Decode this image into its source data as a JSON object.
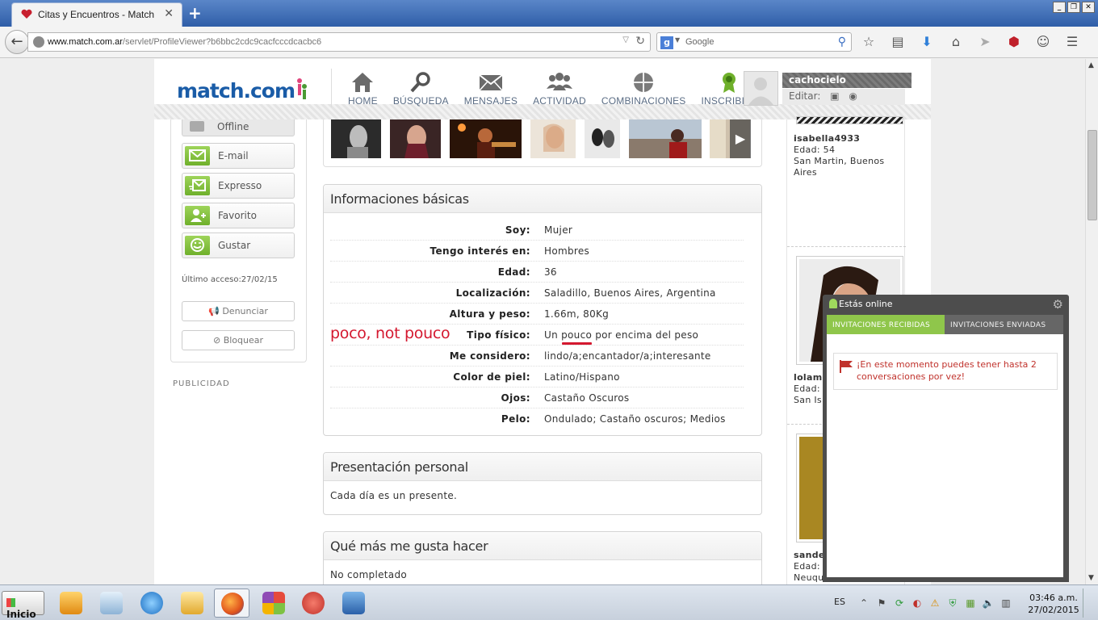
{
  "browser": {
    "tab_title": "Citas y Encuentros - Match",
    "url_domain": "www.match.com.ar",
    "url_path": "/servlet/ProfileViewer?b6bbc2cdc9cacfcccdcacbc6",
    "search_placeholder": "Google",
    "new_tab": "+",
    "close_tab": "✕"
  },
  "site": {
    "logo_text": "match.com",
    "nav": [
      {
        "label": "HOME",
        "icon": "home-icon"
      },
      {
        "label": "BÚSQUEDA",
        "icon": "search-icon"
      },
      {
        "label": "MENSAJES",
        "icon": "envelope-icon"
      },
      {
        "label": "ACTIVIDAD",
        "icon": "people-icon"
      },
      {
        "label": "COMBINACIONES",
        "icon": "puzzle-icon"
      },
      {
        "label": "INSCRIBITE",
        "icon": "ribbon-icon"
      }
    ],
    "user": {
      "name": "cachocielo",
      "edit_label": "Editar:"
    }
  },
  "sidebar": {
    "status": "Offline",
    "actions": [
      "E-mail",
      "Expresso",
      "Favorito",
      "Gustar"
    ],
    "last_access": "Último acceso:27/02/15",
    "report": "Denunciar",
    "block": "Bloquear",
    "ads": "PUBLICIDAD"
  },
  "basic_info": {
    "title": "Informaciones básicas",
    "rows": [
      {
        "k": "Soy:",
        "v": "Mujer"
      },
      {
        "k": "Tengo interés en:",
        "v": "Hombres"
      },
      {
        "k": "Edad:",
        "v": "36"
      },
      {
        "k": "Localización:",
        "v": "Saladillo, Buenos Aires, Argentina"
      },
      {
        "k": "Altura y peso:",
        "v": "1.66m, 80Kg"
      },
      {
        "k": "Tipo físico:",
        "v_pre": "Un ",
        "v_mark": "pouco",
        "v_post": " por encima del peso"
      },
      {
        "k": "Me considero:",
        "v": "lindo/a;encantador/a;interesante"
      },
      {
        "k": "Color de piel:",
        "v": "Latino/Hispano"
      },
      {
        "k": "Ojos:",
        "v": "Castaño Oscuros"
      },
      {
        "k": "Pelo:",
        "v": "Ondulado; Castaño oscuros; Medios"
      }
    ],
    "annotation": "poco, not pouco"
  },
  "presentation": {
    "title": "Presentación personal",
    "text": "Cada día es un presente."
  },
  "likes": {
    "title": "Qué más me gusta hacer",
    "text": "No completado"
  },
  "matches": [
    {
      "username": "isabella4933",
      "age": "Edad: 54",
      "location": "San Martin, Buenos Aires"
    },
    {
      "username": "lolama",
      "age": "Edad:",
      "location": "San Is Aires"
    },
    {
      "username": "sander",
      "age": "Edad:",
      "location": "Neuqu"
    }
  ],
  "chat": {
    "title": "Estás online",
    "tab_received": "INVITACIONES RECIBIDAS",
    "tab_sent": "INVITACIONES ENVIADAS",
    "notice": "¡En este momento puedes tener hasta 2 conversaciones por vez!"
  },
  "taskbar": {
    "start": "Inicio",
    "lang": "ES",
    "time": "03:46 a.m.",
    "date": "27/02/2015"
  },
  "colors": {
    "brand": "#1a5ca7",
    "accent_green": "#8fc64b",
    "annotation_red": "#d4182f"
  }
}
